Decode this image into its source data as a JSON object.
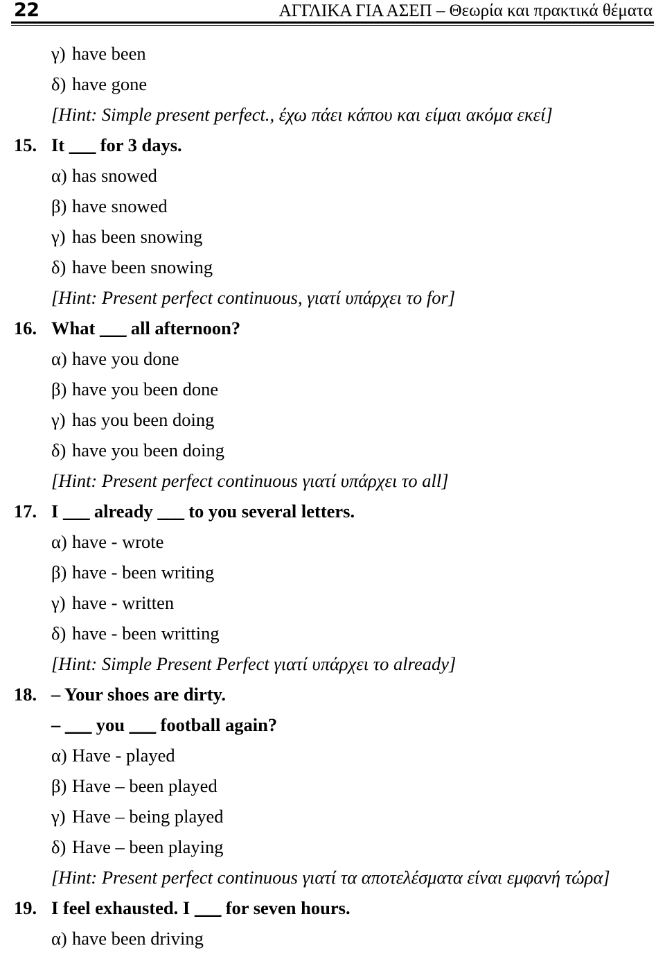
{
  "header": {
    "folio": "22",
    "title": "ΑΓΓΛΙΚΑ ΓΙΑ ΑΣΕΠ – Θεωρία και πρακτικά θέματα"
  },
  "continued_options": [
    {
      "letter": "γ)",
      "text": "have been"
    },
    {
      "letter": "δ)",
      "text": "have gone"
    }
  ],
  "continued_hint": "[Hint: Simple present perfect., έχω πάει κάπου και είμαι ακόμα εκεί]",
  "questions": [
    {
      "number": "15.",
      "stem_before": "It ",
      "blank": "___",
      "stem_after": " for 3 days.",
      "options": [
        {
          "letter": "α)",
          "text": "has snowed"
        },
        {
          "letter": "β)",
          "text": "have snowed"
        },
        {
          "letter": "γ)",
          "text": "has been snowing"
        },
        {
          "letter": "δ)",
          "text": "have been snowing"
        }
      ],
      "hint": "[Hint: Present perfect continuous, γιατί υπάρχει το for]"
    },
    {
      "number": "16.",
      "stem_before": "What ",
      "blank": "___",
      "stem_after": " all afternoon?",
      "options": [
        {
          "letter": "α)",
          "text": "have you done"
        },
        {
          "letter": "β)",
          "text": "have you been done"
        },
        {
          "letter": "γ)",
          "text": "has you been doing"
        },
        {
          "letter": "δ)",
          "text": "have you been doing"
        }
      ],
      "hint": "[Hint: Present perfect continuous γιατί υπάρχει το all]"
    },
    {
      "number": "17.",
      "stem_before": "I ",
      "blank": "___",
      "stem_mid": " already ",
      "blank2": "___",
      "stem_after": " to you several letters.",
      "options": [
        {
          "letter": "α)",
          "text": "have - wrote"
        },
        {
          "letter": "β)",
          "text": "have - been writing"
        },
        {
          "letter": "γ)",
          "text": "have - written"
        },
        {
          "letter": "δ)",
          "text": "have - been writting"
        }
      ],
      "hint": "[Hint: Simple Present Perfect γιατί υπάρχει το already]"
    },
    {
      "number": "18.",
      "dialog_line_1": "– Your shoes are dirty.",
      "dialog_2_before": "– ",
      "blank": "___",
      "dialog_2_mid": " you ",
      "blank2": "___",
      "dialog_2_after": " football again?",
      "options": [
        {
          "letter": "α)",
          "text": "Have - played"
        },
        {
          "letter": "β)",
          "text": "Have – been played"
        },
        {
          "letter": "γ)",
          "text": "Have – being played"
        },
        {
          "letter": "δ)",
          "text": "Have – been playing"
        }
      ],
      "hint": "[Hint: Present perfect continuous γιατί τα αποτελέσματα είναι εμφανή τώρα]"
    },
    {
      "number": "19.",
      "stem_before": "I feel exhausted. I ",
      "blank": "___",
      "stem_after": " for seven hours.",
      "options": [
        {
          "letter": "α)",
          "text": "have been driving"
        }
      ],
      "hint": ""
    }
  ]
}
